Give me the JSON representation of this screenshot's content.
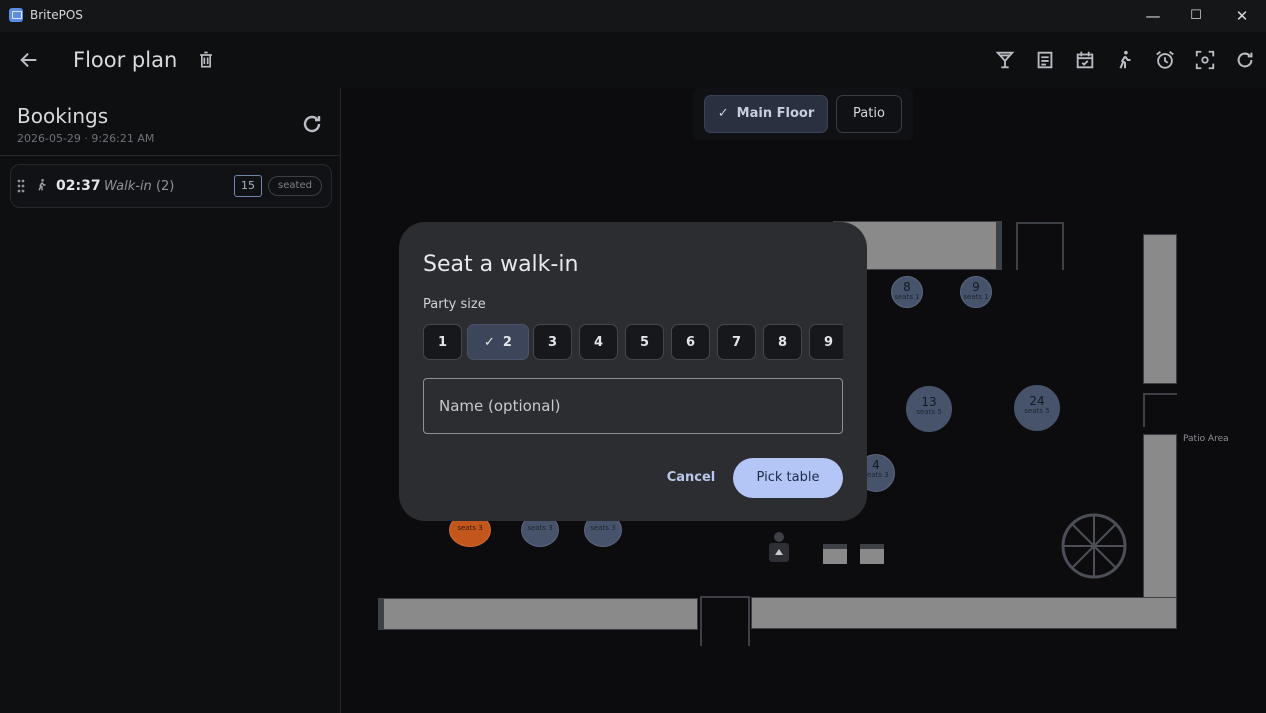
{
  "window": {
    "title": "BritePOS",
    "minimize": "—",
    "maximize": "☐",
    "close": "✕"
  },
  "header": {
    "title": "Floor plan"
  },
  "sidebar": {
    "title": "Bookings",
    "subtitle": "2026-05-29 · 9:26:21 AM",
    "bookings": [
      {
        "time": "02:37",
        "name": "Walk-in",
        "party": "(2)",
        "table": "15",
        "status": "seated"
      }
    ]
  },
  "floor": {
    "zones": [
      {
        "label": "Main Floor",
        "active": true
      },
      {
        "label": "Patio",
        "active": false
      }
    ],
    "area_label": "Patio Area",
    "tables": [
      {
        "number": "8",
        "seats": "seats 1"
      },
      {
        "number": "9",
        "seats": "seats 1"
      },
      {
        "number": "13",
        "seats": "seats 5"
      },
      {
        "number": "24",
        "seats": "seats 5"
      },
      {
        "number": "4",
        "seats": "seats 3"
      },
      {
        "number": "",
        "seats": "seats 3"
      },
      {
        "number": "",
        "seats": "seats 3"
      },
      {
        "number": "",
        "seats": "seats 3"
      }
    ]
  },
  "dialog": {
    "title": "Seat a walk-in",
    "party_label": "Party size",
    "party_sizes": [
      "1",
      "2",
      "3",
      "4",
      "5",
      "6",
      "7",
      "8",
      "9"
    ],
    "selected_party": "2",
    "name_placeholder": "Name (optional)",
    "name_value": "",
    "cancel_label": "Cancel",
    "confirm_label": "Pick table"
  }
}
